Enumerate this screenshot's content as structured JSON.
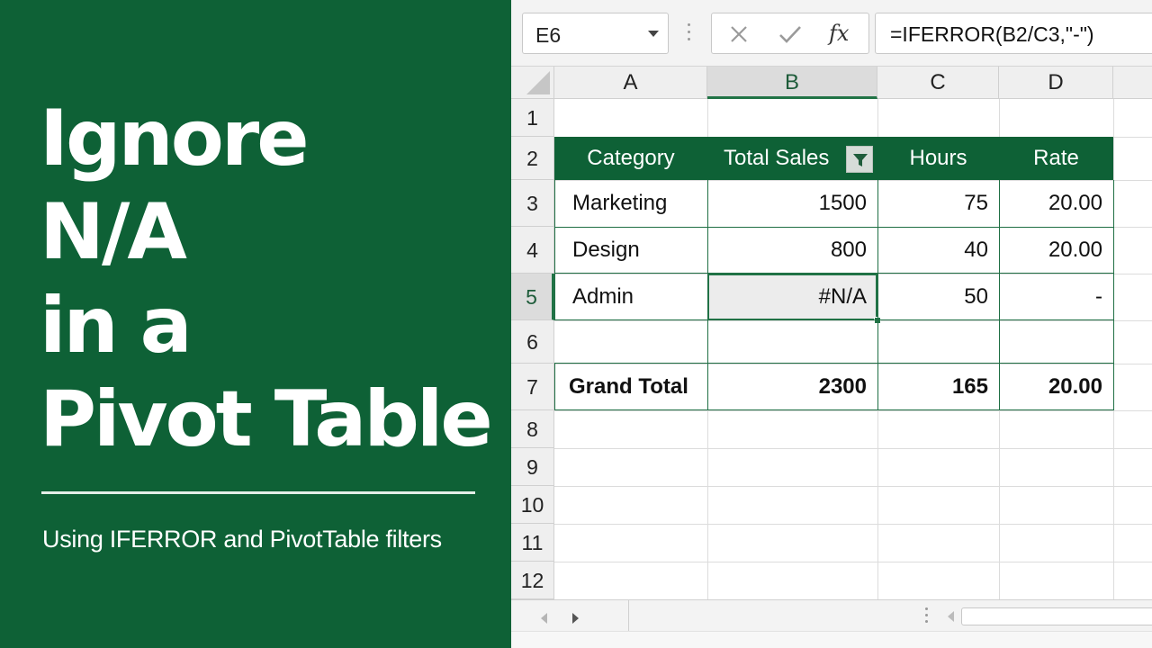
{
  "title": {
    "lines": [
      "Ignore",
      "N/A",
      "in a",
      "Pivot Table"
    ],
    "subtitle": "Using IFERROR and PivotTable filters"
  },
  "formula_bar": {
    "name_box": "E6",
    "fx_label": "fx",
    "formula": "=IFERROR(B2/C3,\"-\")"
  },
  "sheet": {
    "columns": [
      "A",
      "B",
      "C",
      "D"
    ],
    "rows": [
      "1",
      "2",
      "3",
      "4",
      "5",
      "6",
      "7",
      "8",
      "9",
      "10",
      "11",
      "12"
    ],
    "active_column": "B",
    "active_row": "5"
  },
  "pivot": {
    "headers": [
      "Category",
      "Total Sales",
      "Hours",
      "Rate"
    ],
    "rows": [
      [
        "Marketing",
        "1500",
        "75",
        "20.00"
      ],
      [
        "Design",
        "800",
        "40",
        "20.00"
      ],
      [
        "Admin",
        "#N/A",
        "50",
        "-"
      ]
    ],
    "grand_total": [
      "Grand Total",
      "2300",
      "165",
      "20.00"
    ]
  },
  "colors": {
    "brand_green": "#0e6136",
    "excel_green": "#217346"
  }
}
